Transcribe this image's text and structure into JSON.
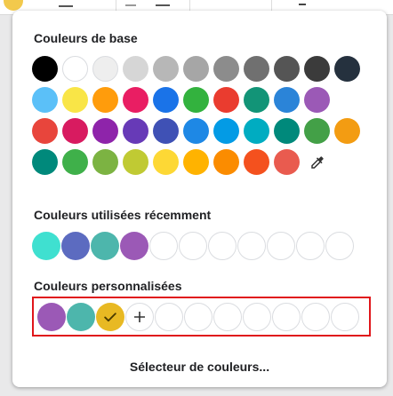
{
  "sections": {
    "base_title": "Couleurs de base",
    "recent_title": "Couleurs utilisées récemment",
    "custom_title": "Couleurs personnalisées"
  },
  "base_colors": [
    [
      "#000000",
      "#ffffff",
      "#eeeeee",
      "#d6d6d6",
      "#b7b7b7",
      "#a6a6a6",
      "#8c8c8c",
      "#707070",
      "#555555",
      "#3b3b3b",
      "#25313e"
    ],
    [
      "#5bc0f8",
      "#f9e547",
      "#ff9c0c",
      "#e91e63",
      "#1a73e8",
      "#33b23e",
      "#ea3c2f",
      "#129477",
      "#2b84d8",
      "#9b59b6"
    ],
    [
      "#e8453c",
      "#d81b60",
      "#8e24aa",
      "#673ab7",
      "#3f51b5",
      "#1e88e5",
      "#039be5",
      "#00acc1",
      "#00897b",
      "#43a047",
      "#f39c12"
    ],
    [
      "#00897b",
      "#3fb04a",
      "#7cb342",
      "#c0ca33",
      "#fdd835",
      "#ffb300",
      "#fb8c00",
      "#f4511e",
      "#e95b4f"
    ]
  ],
  "eyedropper_icon": "eyedropper-icon",
  "recent_colors": [
    "#3fe0d0",
    "#5c6bc0",
    "#4db6ac",
    "#9b59b6"
  ],
  "recent_empty_count": 7,
  "custom_colors": [
    "#9b59b6",
    "#4db6ac",
    "#e8b923"
  ],
  "custom_selected_index": 2,
  "custom_empty_count": 7,
  "add_icon": "plus-icon",
  "picker_label": "Sélecteur de couleurs..."
}
